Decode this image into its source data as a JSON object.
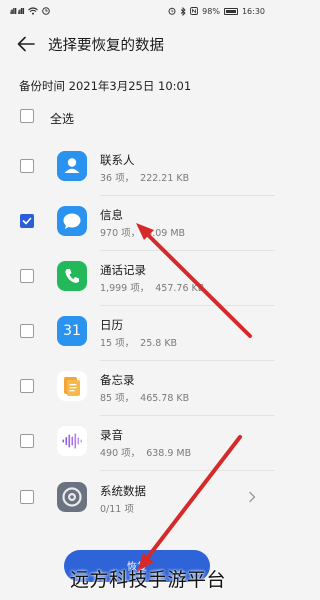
{
  "status_bar": {
    "signal_text": "ᵢıll ᵢıll",
    "time": "16:30",
    "battery": "98%",
    "left_icons": [
      "signal-icon",
      "wifi-icon",
      "clock-icon"
    ],
    "right_icons": [
      "alarm-icon",
      "bluetooth-icon",
      "nfc-icon",
      "battery-icon"
    ]
  },
  "header": {
    "title": "选择要恢复的数据",
    "back_icon": "arrow-left-icon"
  },
  "backup_time": "备份时间 2021年3月25日 10:01",
  "select_all": {
    "label": "全选",
    "checked": false
  },
  "items": [
    {
      "name": "联系人",
      "meta": "36 项，  222.21 KB",
      "icon": "contacts-icon",
      "checked": false
    },
    {
      "name": "信息",
      "meta": "970 项，  3.09 MB",
      "icon": "messages-icon",
      "checked": true
    },
    {
      "name": "通话记录",
      "meta": "1,999 项，  457.76 KB",
      "icon": "phone-icon",
      "checked": false
    },
    {
      "name": "日历",
      "meta": "15 项，  25.8 KB",
      "icon": "calendar-icon",
      "calendar_day": "31",
      "checked": false
    },
    {
      "name": "备忘录",
      "meta": "85 项，  465.78 KB",
      "icon": "notes-icon",
      "checked": false
    },
    {
      "name": "录音",
      "meta": "490 项，  638.9 MB",
      "icon": "recorder-icon",
      "checked": false
    },
    {
      "name": "系统数据",
      "meta": "0/11 项",
      "icon": "settings-icon",
      "checked": false,
      "has_chevron": true
    }
  ],
  "restore_button": {
    "label": "恢复"
  },
  "watermark": "远方科技手游平台",
  "colors": {
    "accent": "#2f64d8",
    "annotation_arrow": "#d62a2a"
  }
}
